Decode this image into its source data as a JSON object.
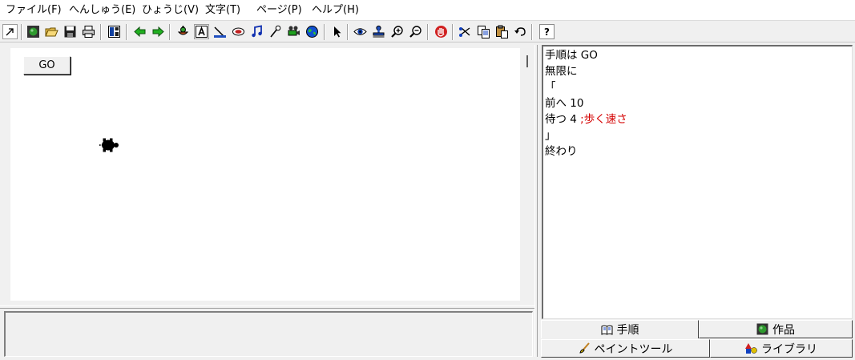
{
  "menu": {
    "items": [
      "ファイル(F)",
      "へんしゅう(E)",
      "ひょうじ(V)",
      "文字(T)",
      "ページ(P)",
      "ヘルプ(H)"
    ]
  },
  "toolbar": {
    "help_label": "?"
  },
  "canvas": {
    "go_button_label": "GO"
  },
  "editor": {
    "lines": {
      "l1": "手順は GO",
      "l2": "無限に",
      "l3": "「",
      "l4": "前へ 10",
      "l5_code": "待つ 4 ",
      "l5_comment": ";歩く速さ",
      "l6": "」",
      "l7": "終わり"
    },
    "comment_color": "#d40000"
  },
  "tabs": {
    "procedure": "手順",
    "works": "作品",
    "paint_tool": "ペイントツール",
    "library": "ライブラリ"
  }
}
